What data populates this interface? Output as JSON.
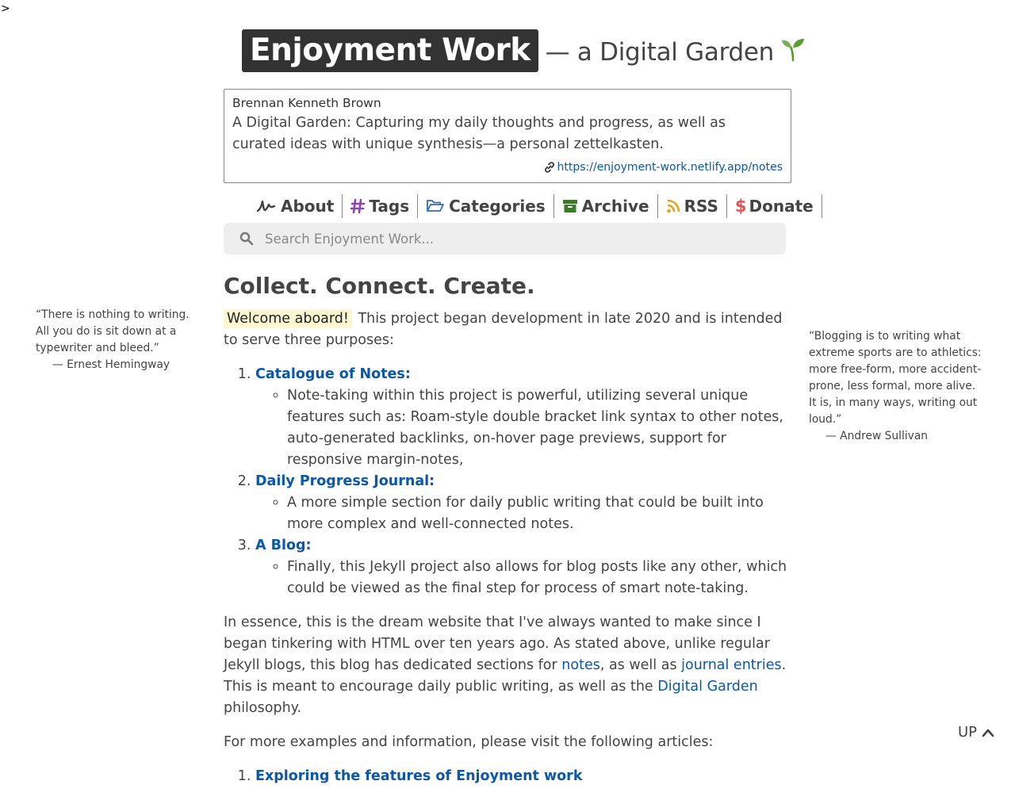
{
  "stray_char": ">",
  "header": {
    "title": "Enjoyment Work",
    "subtitle": "— a Digital Garden"
  },
  "info": {
    "author": "Brennan Kenneth Brown",
    "description": "A Digital Garden: Capturing my daily thoughts and progress, as well as curated ideas with unique synthesis—a personal zettelkasten.",
    "url": "https://enjoyment-work.netlify.app/notes"
  },
  "nav": {
    "items": [
      {
        "label": "About",
        "icon": "signature-icon",
        "color": "#444444"
      },
      {
        "label": "Tags",
        "icon": "hash-icon",
        "color": "#8e44ad"
      },
      {
        "label": "Categories",
        "icon": "folder-open-icon",
        "color": "#2f6db5"
      },
      {
        "label": "Archive",
        "icon": "archive-box-icon",
        "color": "#3d7a2c"
      },
      {
        "label": "RSS",
        "icon": "rss-icon",
        "color": "#e0a526"
      },
      {
        "label": "Donate",
        "icon": "dollar-icon",
        "color": "#e0555a"
      }
    ]
  },
  "search": {
    "placeholder": "Search Enjoyment Work..."
  },
  "main": {
    "heading": "Collect. Connect. Create.",
    "welcome": "Welcome aboard!",
    "intro": "This project began development in late 2020 and is intended to serve three purposes:",
    "purposes": [
      {
        "title": "Catalogue of Notes:",
        "detail": "Note-taking within this project is powerful, utilizing several unique features such as: Roam-style double bracket link syntax to other notes, auto-generated backlinks, on-hover page previews, support for responsive margin-notes,"
      },
      {
        "title": "Daily Progress Journal:",
        "detail": "A more simple section for daily public writing that could be built into more complex and well-connected notes."
      },
      {
        "title": "A Blog:",
        "detail": "Finally, this Jekyll project also allows for blog posts like any other, which could be viewed as the final step for process of smart note-taking."
      }
    ],
    "essence": {
      "p1": "In essence, this is the dream website that I've always wanted to make since I began tinkering with HTML over ten years ago. As stated above, unlike regular Jekyll blogs, this blog has dedicated sections for ",
      "link_notes": "notes",
      "p2": ", as well as ",
      "link_journal": "journal entries",
      "p3": ". This is meant to encourage daily public writing, as well as the ",
      "link_garden": "Digital Garden",
      "p4": " philosophy."
    },
    "more_info": "For more examples and information, please visit the following articles:",
    "articles": [
      {
        "title": "Exploring the features of Enjoyment work"
      }
    ]
  },
  "quotes": {
    "left": {
      "text": "“There is nothing to writing. All you do is sit down at a typewriter and bleed.”",
      "author": "— Ernest Hemingway"
    },
    "right": {
      "text": "“Blogging is to writing what extreme sports are to athletics: more free-form, more accident-prone, less formal, more alive. It is, in many ways, writing out loud.”",
      "author": "— Andrew Sullivan"
    }
  },
  "back_to_top": "UP"
}
